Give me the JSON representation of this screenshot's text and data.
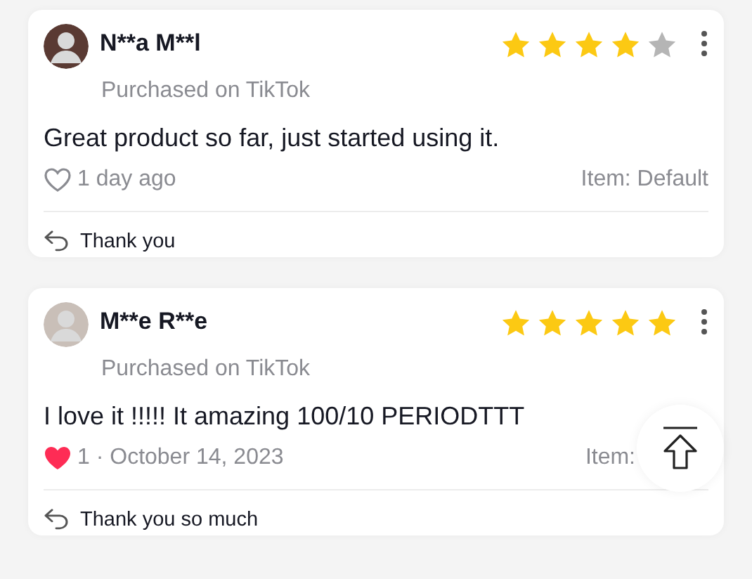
{
  "reviews": [
    {
      "name": "N**a M**l",
      "source": "Purchased on TikTok",
      "stars": 4,
      "text": "Great product so far, just started using it.",
      "liked": false,
      "meta": "1 day ago",
      "item": "Item: Default",
      "reply": "Thank you"
    },
    {
      "name": "M**e R**e",
      "source": "Purchased on TikTok",
      "stars": 5,
      "text": "I love it !!!!! It amazing 100/10 PERIODTTT",
      "liked": true,
      "meta": "1 · October 14, 2023",
      "item": "Item:",
      "reply": "Thank you so much"
    }
  ]
}
